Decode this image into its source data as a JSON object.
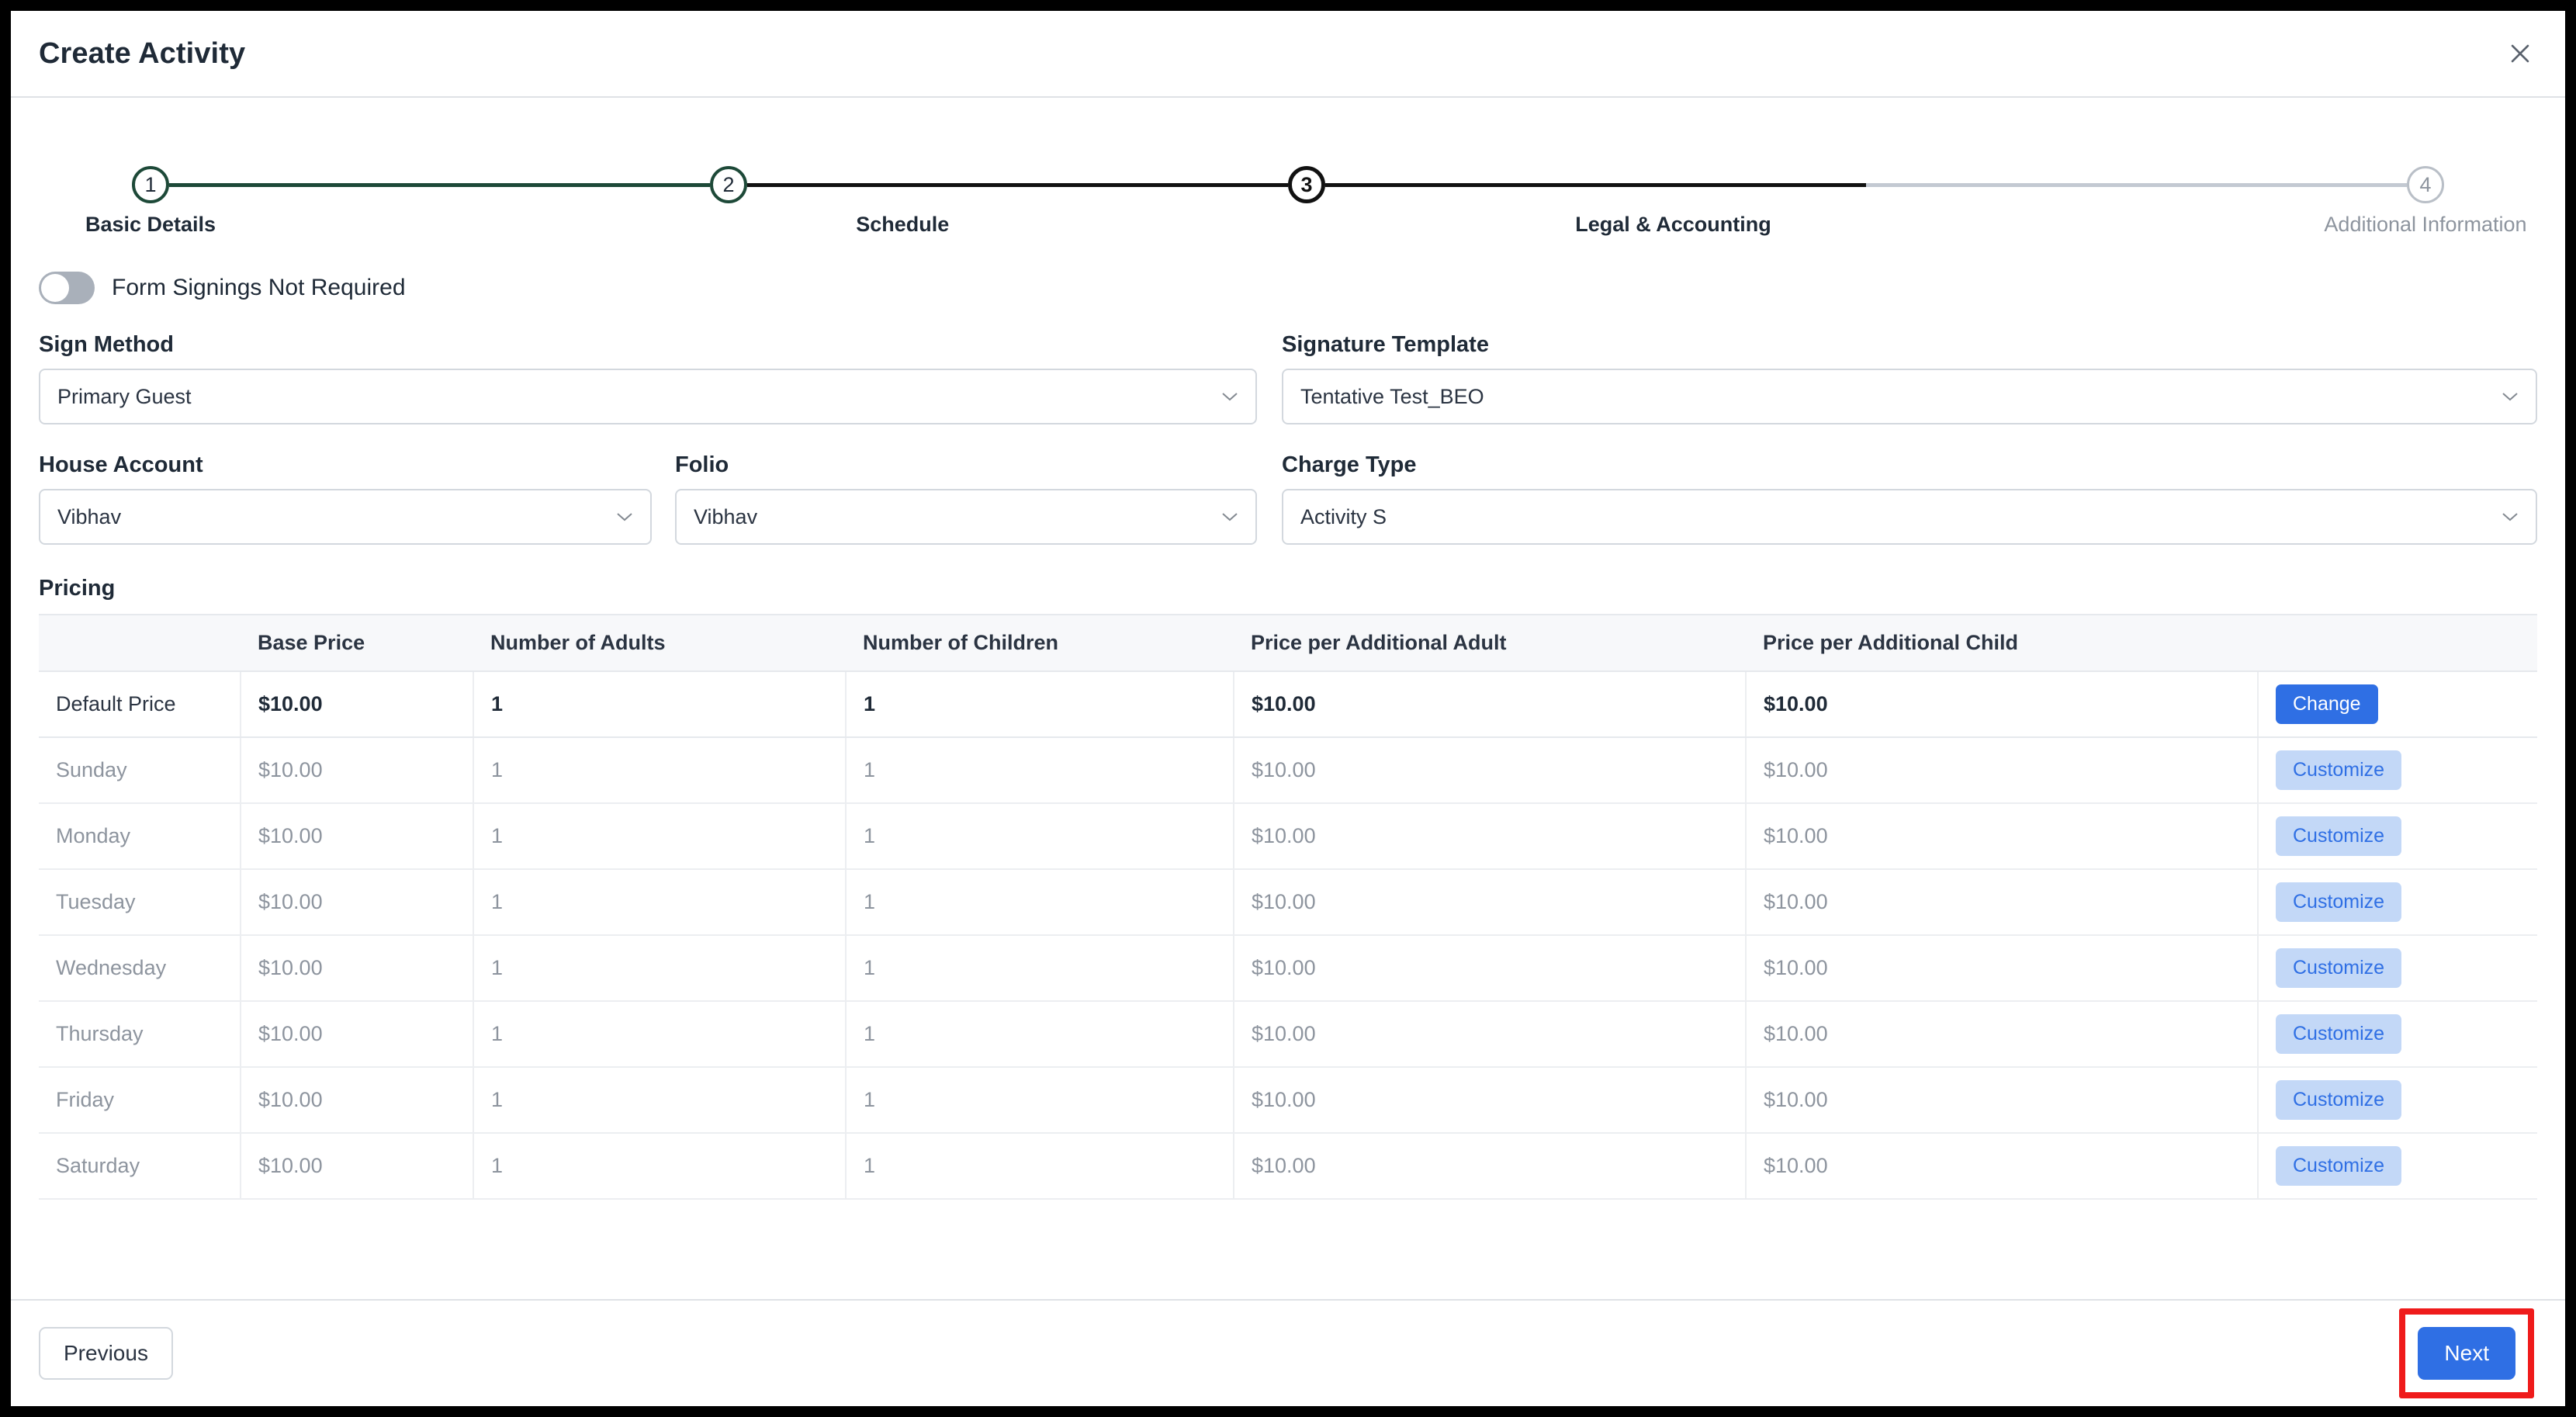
{
  "window": {
    "title": "Create Activity",
    "close_icon": "close-icon"
  },
  "stepper": {
    "steps": [
      {
        "number": "1",
        "label": "Basic Details",
        "state": "done"
      },
      {
        "number": "2",
        "label": "Schedule",
        "state": "done"
      },
      {
        "number": "3",
        "label": "Legal & Accounting",
        "state": "active"
      },
      {
        "number": "4",
        "label": "Additional Information",
        "state": "todo"
      }
    ],
    "colors": {
      "completed_line": "#1d4938",
      "active_line": "#111111",
      "upcoming_line": "#c3c9d2"
    }
  },
  "toggle": {
    "label": "Form Signings Not Required",
    "state": "off"
  },
  "fields": {
    "sign_method": {
      "label": "Sign Method",
      "value": "Primary Guest"
    },
    "signature_template": {
      "label": "Signature Template",
      "value": "Tentative Test_BEO"
    },
    "house_account": {
      "label": "House Account",
      "value": "Vibhav"
    },
    "folio": {
      "label": "Folio",
      "value": "Vibhav"
    },
    "charge_type": {
      "label": "Charge Type",
      "value": "Activity S"
    }
  },
  "pricing": {
    "section_title": "Pricing",
    "columns": [
      "",
      "Base Price",
      "Number of Adults",
      "Number of Children",
      "Price per Additional Adult",
      "Price per Additional Child",
      ""
    ],
    "default_row": {
      "label": "Default Price",
      "base_price": "$10.00",
      "adults": "1",
      "children": "1",
      "price_additional_adult": "$10.00",
      "price_additional_child": "$10.00",
      "action": "Change"
    },
    "day_rows": [
      {
        "label": "Sunday",
        "base_price": "$10.00",
        "adults": "1",
        "children": "1",
        "price_additional_adult": "$10.00",
        "price_additional_child": "$10.00",
        "action": "Customize"
      },
      {
        "label": "Monday",
        "base_price": "$10.00",
        "adults": "1",
        "children": "1",
        "price_additional_adult": "$10.00",
        "price_additional_child": "$10.00",
        "action": "Customize"
      },
      {
        "label": "Tuesday",
        "base_price": "$10.00",
        "adults": "1",
        "children": "1",
        "price_additional_adult": "$10.00",
        "price_additional_child": "$10.00",
        "action": "Customize"
      },
      {
        "label": "Wednesday",
        "base_price": "$10.00",
        "adults": "1",
        "children": "1",
        "price_additional_adult": "$10.00",
        "price_additional_child": "$10.00",
        "action": "Customize"
      },
      {
        "label": "Thursday",
        "base_price": "$10.00",
        "adults": "1",
        "children": "1",
        "price_additional_adult": "$10.00",
        "price_additional_child": "$10.00",
        "action": "Customize"
      },
      {
        "label": "Friday",
        "base_price": "$10.00",
        "adults": "1",
        "children": "1",
        "price_additional_adult": "$10.00",
        "price_additional_child": "$10.00",
        "action": "Customize"
      },
      {
        "label": "Saturday",
        "base_price": "$10.00",
        "adults": "1",
        "children": "1",
        "price_additional_adult": "$10.00",
        "price_additional_child": "$10.00",
        "action": "Customize"
      }
    ]
  },
  "footer": {
    "previous_label": "Previous",
    "next_label": "Next"
  },
  "annotation": {
    "highlight_color": "#ef1b1b",
    "target": "Next"
  },
  "accent_colors": {
    "primary_button": "#2f6fe4",
    "secondary_button_bg": "#c3d8f7",
    "secondary_button_text": "#2f6fe4"
  }
}
